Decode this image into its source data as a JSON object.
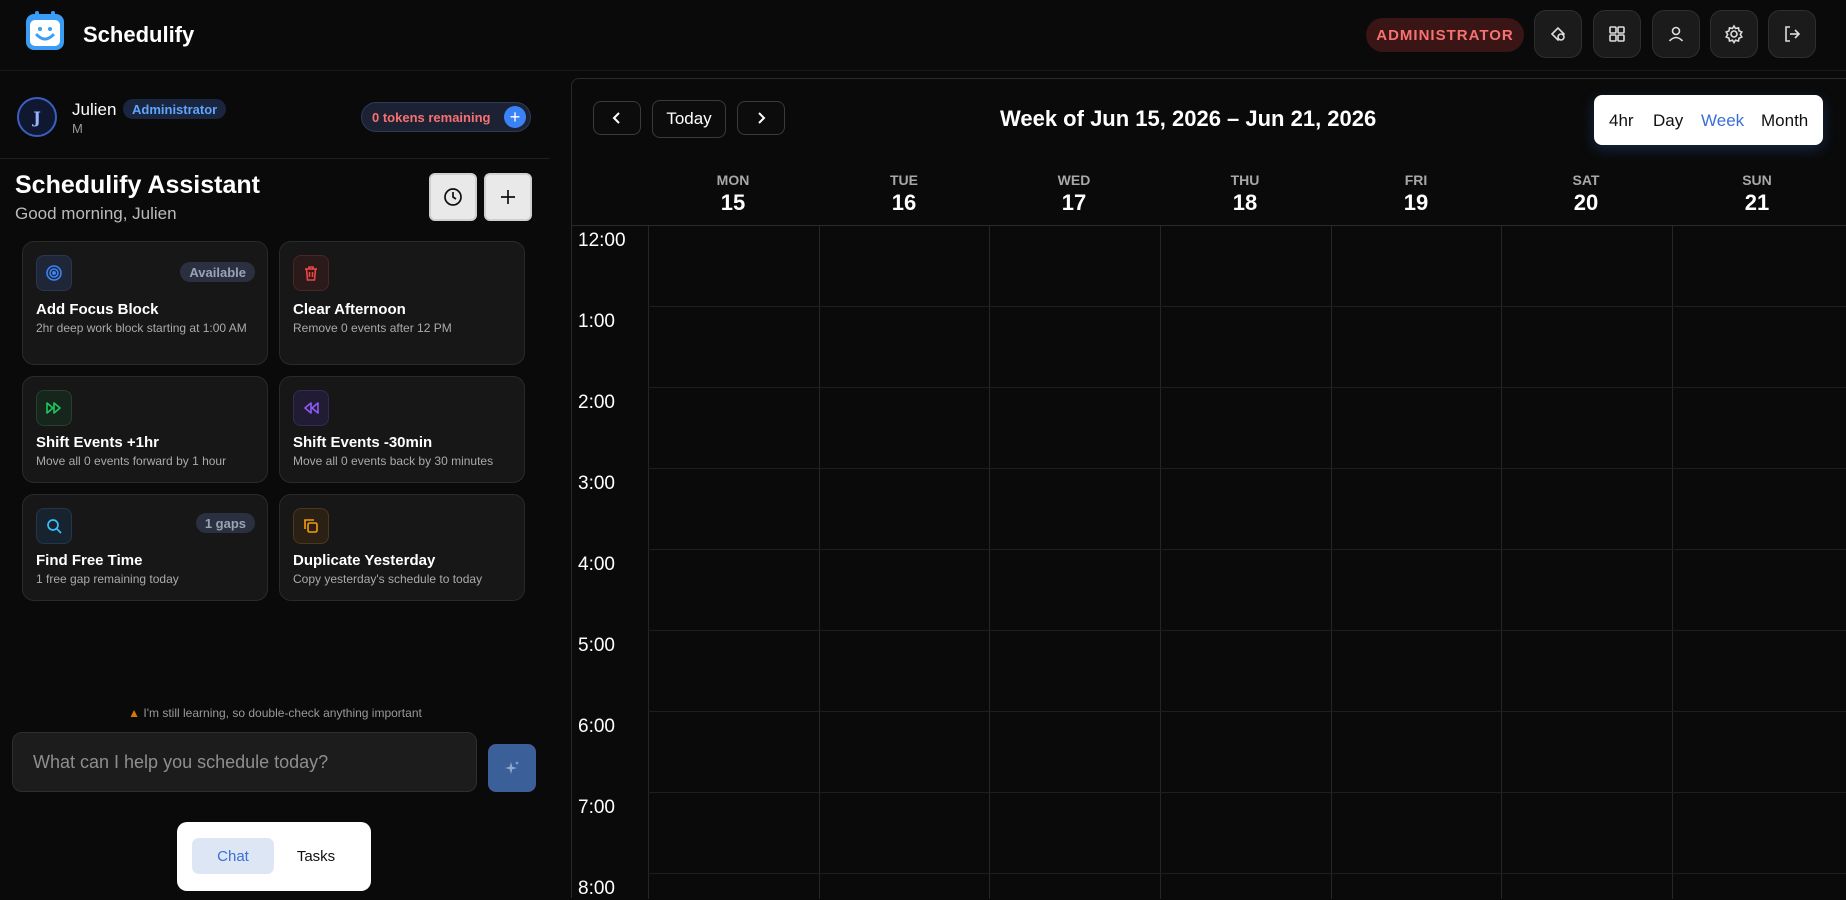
{
  "app": {
    "name": "Schedulify"
  },
  "header": {
    "role_pill": "ADMINISTRATOR",
    "buttons": [
      "integrations-icon",
      "apps-grid-icon",
      "user-icon",
      "gear-icon",
      "logout-icon"
    ]
  },
  "user": {
    "initial": "J",
    "name": "Julien",
    "role": "Administrator",
    "sub": "M",
    "tokens": "0 tokens remaining"
  },
  "assistant": {
    "title": "Schedulify Assistant",
    "greeting": "Good morning, Julien"
  },
  "quick_actions": [
    {
      "title": "Add Focus Block",
      "desc": "2hr deep work block starting at 1:00 AM",
      "badge": "Available",
      "icon": "target-icon",
      "color": "#3b82f6"
    },
    {
      "title": "Clear Afternoon",
      "desc": "Remove 0 events after 12 PM",
      "badge": "",
      "icon": "trash-icon",
      "color": "#ef4444"
    },
    {
      "title": "Shift Events +1hr",
      "desc": "Move all 0 events forward by 1 hour",
      "badge": "",
      "icon": "fast-forward-icon",
      "color": "#22c55e"
    },
    {
      "title": "Shift Events -30min",
      "desc": "Move all 0 events back by 30 minutes",
      "badge": "",
      "icon": "rewind-icon",
      "color": "#8b5cf6"
    },
    {
      "title": "Find Free Time",
      "desc": "1 free gap remaining today",
      "badge": "1 gaps",
      "icon": "search-icon",
      "color": "#38bdf8"
    },
    {
      "title": "Duplicate Yesterday",
      "desc": "Copy yesterday's schedule to today",
      "badge": "",
      "icon": "copy-icon",
      "color": "#f59e0b"
    }
  ],
  "chat": {
    "disclaimer": "I'm still learning, so double-check anything important",
    "placeholder": "What can I help you schedule today?",
    "modes": {
      "chat": "Chat",
      "tasks": "Tasks"
    }
  },
  "calendar": {
    "today_label": "Today",
    "title": "Week of Jun 15, 2026 – Jun 21, 2026",
    "views": [
      "4hr",
      "Day",
      "Week",
      "Month"
    ],
    "active_view": "Week",
    "days": [
      {
        "dow": "MON",
        "num": "15"
      },
      {
        "dow": "TUE",
        "num": "16"
      },
      {
        "dow": "WED",
        "num": "17"
      },
      {
        "dow": "THU",
        "num": "18"
      },
      {
        "dow": "FRI",
        "num": "19"
      },
      {
        "dow": "SAT",
        "num": "20"
      },
      {
        "dow": "SUN",
        "num": "21"
      }
    ],
    "hours": [
      "12:00",
      "1:00",
      "2:00",
      "3:00",
      "4:00",
      "5:00",
      "6:00",
      "7:00",
      "8:00"
    ]
  }
}
